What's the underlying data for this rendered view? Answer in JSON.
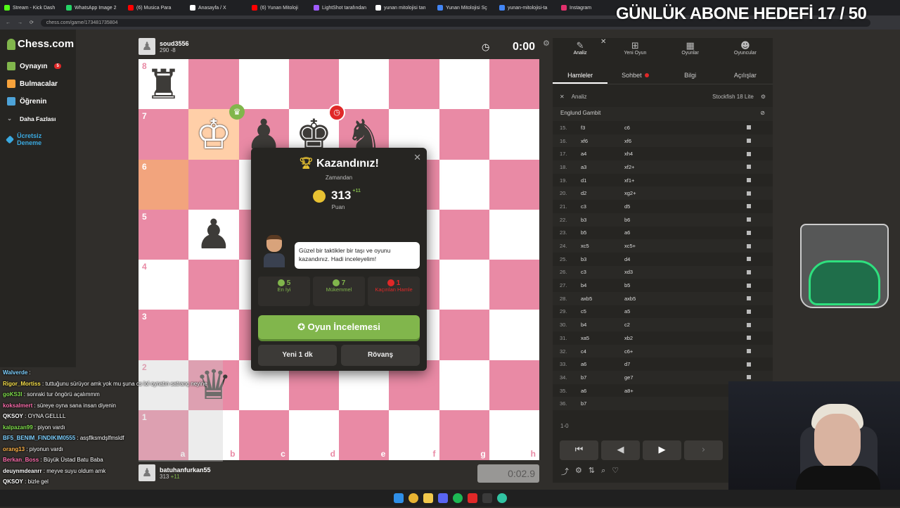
{
  "browser": {
    "tabs": [
      {
        "label": "Stream - Kick Dash",
        "color": "#53fc18"
      },
      {
        "label": "WhatsApp Image 2",
        "color": "#25d366"
      },
      {
        "label": "(6) Musica Para",
        "color": "#ff0000"
      },
      {
        "label": "Anasayfa / X",
        "color": "#ffffff"
      },
      {
        "label": "(6) Yunan Mitoloji",
        "color": "#ff0000"
      },
      {
        "label": "LightShot tarafından",
        "color": "#a05cff"
      },
      {
        "label": "yunan mitolojisi tan",
        "color": "#ffffff"
      },
      {
        "label": "Yunan Mitolojisi Sç",
        "color": "#4285f4"
      },
      {
        "label": "yunan-mitolojisi-ta",
        "color": "#4285f4"
      },
      {
        "label": "Instagram",
        "color": "#e1306c"
      }
    ],
    "url": "chess.com/game/173481735804"
  },
  "overlay": {
    "goal": "GÜNLÜK ABONE HEDEFİ 17 / 50"
  },
  "sidebar": {
    "logo": "Chess.com",
    "items": [
      {
        "label": "Oynayın",
        "badge": "5",
        "color": "#81b64c"
      },
      {
        "label": "Bulmacalar",
        "color": "#f7a23b"
      },
      {
        "label": "Öğrenin",
        "color": "#4da3d8"
      },
      {
        "label": "Daha Fazlası",
        "color": "#aaaaaa"
      },
      {
        "label": "Ücretsiz Deneme",
        "color": "#3aa9e0"
      }
    ]
  },
  "top_player": {
    "name": "soud3556",
    "rating": "290",
    "delta": "-8",
    "clock": "0:00"
  },
  "bottom_player": {
    "name": "batuhanfurkan55",
    "rating": "313",
    "delta": "+11",
    "clock": "0:02.9"
  },
  "board": {
    "ranks": [
      "8",
      "7",
      "6",
      "5",
      "4",
      "3",
      "2",
      "1"
    ],
    "files": [
      "a",
      "b",
      "c",
      "d",
      "e",
      "f",
      "g",
      "h"
    ]
  },
  "modal": {
    "title": "Kazandınız!",
    "reason": "Zamandan",
    "points": "313",
    "points_delta": "+11",
    "points_label": "Puan",
    "coach_message": "Güzel bir taktikler bir taşı ve oyunu kazandınız. Hadi inceleyelim!",
    "stats": [
      {
        "num": "5",
        "label": "En İyi",
        "color": "#81b64c"
      },
      {
        "num": "7",
        "label": "Mükemmel",
        "color": "#81b64c"
      },
      {
        "num": "1",
        "label": "Kaçırılan Hamle",
        "color": "#e02828"
      }
    ],
    "review_button": "Oyun İncelemesi",
    "new_game_button": "Yeni 1 dk",
    "rematch_button": "Rövanş"
  },
  "right_panel": {
    "tabs": [
      "Analiz",
      "Yeni Oyun",
      "Oyunlar",
      "Oyuncular"
    ],
    "subtabs": [
      "Hamleler",
      "Sohbet",
      "Bilgi",
      "Açılışlar"
    ],
    "analysis_label": "Analiz",
    "engine": "Stockfish 18 Lite",
    "opening": "Englund Gambit",
    "moves": [
      {
        "n": "15.",
        "w": "f3",
        "b": "c6"
      },
      {
        "n": "16.",
        "w": "xf6",
        "b": "xf6"
      },
      {
        "n": "17.",
        "w": "a4",
        "b": "xh4"
      },
      {
        "n": "18.",
        "w": "a3",
        "b": "xf2+"
      },
      {
        "n": "19.",
        "w": "d1",
        "b": "xf1+"
      },
      {
        "n": "20.",
        "w": "d2",
        "b": "xg2+"
      },
      {
        "n": "21.",
        "w": "c3",
        "b": "d5"
      },
      {
        "n": "22.",
        "w": "b3",
        "b": "b6"
      },
      {
        "n": "23.",
        "w": "b5",
        "b": "a6"
      },
      {
        "n": "24.",
        "w": "xc5",
        "b": "xc5+"
      },
      {
        "n": "25.",
        "w": "b3",
        "b": "d4"
      },
      {
        "n": "26.",
        "w": "c3",
        "b": "xd3"
      },
      {
        "n": "27.",
        "w": "b4",
        "b": "b5"
      },
      {
        "n": "28.",
        "w": "axb5",
        "b": "axb5"
      },
      {
        "n": "29.",
        "w": "c5",
        "b": "a5"
      },
      {
        "n": "30.",
        "w": "b4",
        "b": "c2"
      },
      {
        "n": "31.",
        "w": "xa5",
        "b": "xb2"
      },
      {
        "n": "32.",
        "w": "c4",
        "b": "c6+"
      },
      {
        "n": "33.",
        "w": "a6",
        "b": "d7"
      },
      {
        "n": "34.",
        "w": "b7",
        "b": "ge7"
      },
      {
        "n": "35.",
        "w": "a6",
        "b": "a8+"
      },
      {
        "n": "36.",
        "w": "b7",
        "b": ""
      }
    ],
    "result": "1-0"
  },
  "chat": [
    {
      "user": "Walverde",
      "msg": "",
      "color": "#7fd1ff"
    },
    {
      "user": "Rigor_Mortiss",
      "msg": "tuttuğunu sürüyor amk yok mu şuna cs lol oynatın satranç neyine",
      "color": "#f7e04b"
    },
    {
      "user": "goKS3l",
      "msg": "sonraki tur öngörü açalımmm",
      "color": "#81e04c"
    },
    {
      "user": "koksalmert",
      "msg": "süreye oyna sana insan diyenin",
      "color": "#ff6fae"
    },
    {
      "user": "QKSOY",
      "msg": "OYNA GELLLL",
      "color": "#ffffff"
    },
    {
      "user": "kalpazan99",
      "msg": "piyon vardı",
      "color": "#81e04c"
    },
    {
      "user": "BF5_BENIM_FINDIKIM0555",
      "msg": "asşflksmdşlfmsldf",
      "color": "#7fd1ff"
    },
    {
      "user": "orang13",
      "msg": "piyonun vardı",
      "color": "#ffb347"
    },
    {
      "user": "Berkan_Boss",
      "msg": "Büyük Üstad Batu Baba",
      "color": "#ff6fae"
    },
    {
      "user": "deuynmdeanrr",
      "msg": "meyve suyu oldum amk",
      "color": "#ffffff"
    },
    {
      "user": "QKSOY",
      "msg": "bizle gel",
      "color": "#ffffff"
    }
  ]
}
